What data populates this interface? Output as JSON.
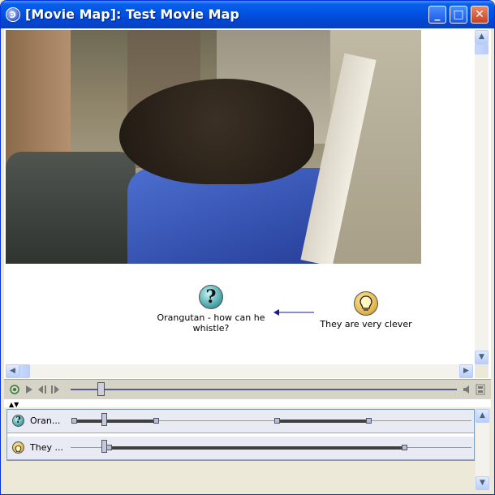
{
  "window": {
    "title": "[Movie Map]: Test Movie Map",
    "app_icon_glyph": "Ͽ",
    "buttons": {
      "minimize": "_",
      "maximize": "□",
      "close": "✕"
    }
  },
  "map": {
    "nodes": [
      {
        "icon": "question-icon",
        "glyph": "?",
        "label": "Orangutan - how can he whistle?"
      },
      {
        "icon": "lightbulb-icon",
        "label": "They are very clever"
      }
    ],
    "link_color": "#1a1a8a"
  },
  "transport": {
    "position": 0.07
  },
  "timeline": {
    "collapse_glyph": "▲▼",
    "tracks": [
      {
        "icon": "question-icon",
        "glyph": "?",
        "label": "Oran..."
      },
      {
        "icon": "lightbulb-icon",
        "label": "They ..."
      }
    ]
  },
  "colors": {
    "titlebar": "#0055e5",
    "track_bar": "#3d403d",
    "row_bg": "#e8eaf4"
  }
}
